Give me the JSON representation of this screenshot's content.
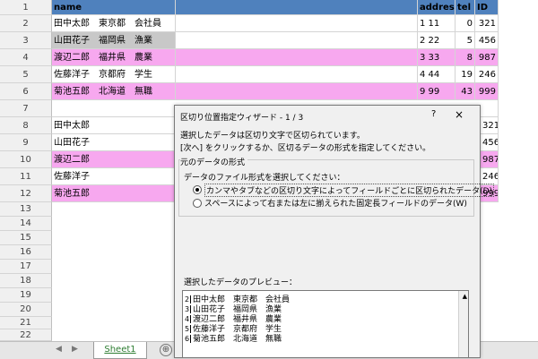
{
  "sheet": {
    "header": {
      "row_no": "1",
      "name": "name",
      "address": "address",
      "tel": "tel",
      "id": "ID"
    },
    "rows_top": [
      {
        "row_no": "2",
        "name": "田中太郎　東京都　会社員",
        "address": "1 11",
        "tel": "0",
        "id": "321",
        "style": ""
      },
      {
        "row_no": "3",
        "name": "山田花子　福岡県　漁業",
        "address": "2 22",
        "tel": "5",
        "id": "456",
        "style": "gray"
      },
      {
        "row_no": "4",
        "name": "渡辺二郎　福井県　農業",
        "address": "3 33",
        "tel": "8",
        "id": "987",
        "style": "pink"
      },
      {
        "row_no": "5",
        "name": "佐藤洋子　京都府　学生",
        "address": "4 44",
        "tel": "19",
        "id": "246",
        "style": ""
      },
      {
        "row_no": "6",
        "name": "菊池五郎　北海道　無職",
        "address": "9 99",
        "tel": "43",
        "id": "999",
        "style": "pink"
      }
    ],
    "row7": "7",
    "rows_bottom": [
      {
        "row_no": "8",
        "name": "田中太郎",
        "id": "321",
        "style": ""
      },
      {
        "row_no": "9",
        "name": "山田花子",
        "id": "456",
        "style": ""
      },
      {
        "row_no": "10",
        "name": "渡辺二郎",
        "id": "987",
        "style": "pink"
      },
      {
        "row_no": "11",
        "name": "佐藤洋子",
        "id": "246",
        "style": ""
      },
      {
        "row_no": "12",
        "name": "菊池五郎",
        "id": "999",
        "style": "pink"
      }
    ],
    "empty_rows": [
      "13",
      "14",
      "15",
      "16",
      "17",
      "18",
      "19",
      "20",
      "21",
      "22"
    ],
    "sheet_tab": "Sheet1",
    "add_sheet": "⊕"
  },
  "dialog": {
    "title": "区切り位置指定ウィザード - 1 / 3",
    "help": "?",
    "close": "×",
    "line1": "選択したデータは区切り文字で区切られています。",
    "line2": "[次へ] をクリックするか、区切るデータの形式を指定してください。",
    "group_label": "元のデータの形式",
    "group_prompt": "データのファイル形式を選択してください：",
    "option1": "カンマやタブなどの区切り文字によってフィールドごとに区切られたデータ(D)",
    "option2": "スペースによって右または左に揃えられた固定長フィールドのデータ(W)",
    "preview_label": "選択したデータのプレビュー：",
    "preview_lines": [
      {
        "num": "2",
        "text": "田中太郎　東京都　会社員"
      },
      {
        "num": "3",
        "text": "山田花子　福岡県　漁業"
      },
      {
        "num": "4",
        "text": "渡辺二郎　福井県　農業"
      },
      {
        "num": "5",
        "text": "佐藤洋子　京都府　学生"
      },
      {
        "num": "6",
        "text": "菊池五郎　北海道　無職"
      }
    ]
  }
}
